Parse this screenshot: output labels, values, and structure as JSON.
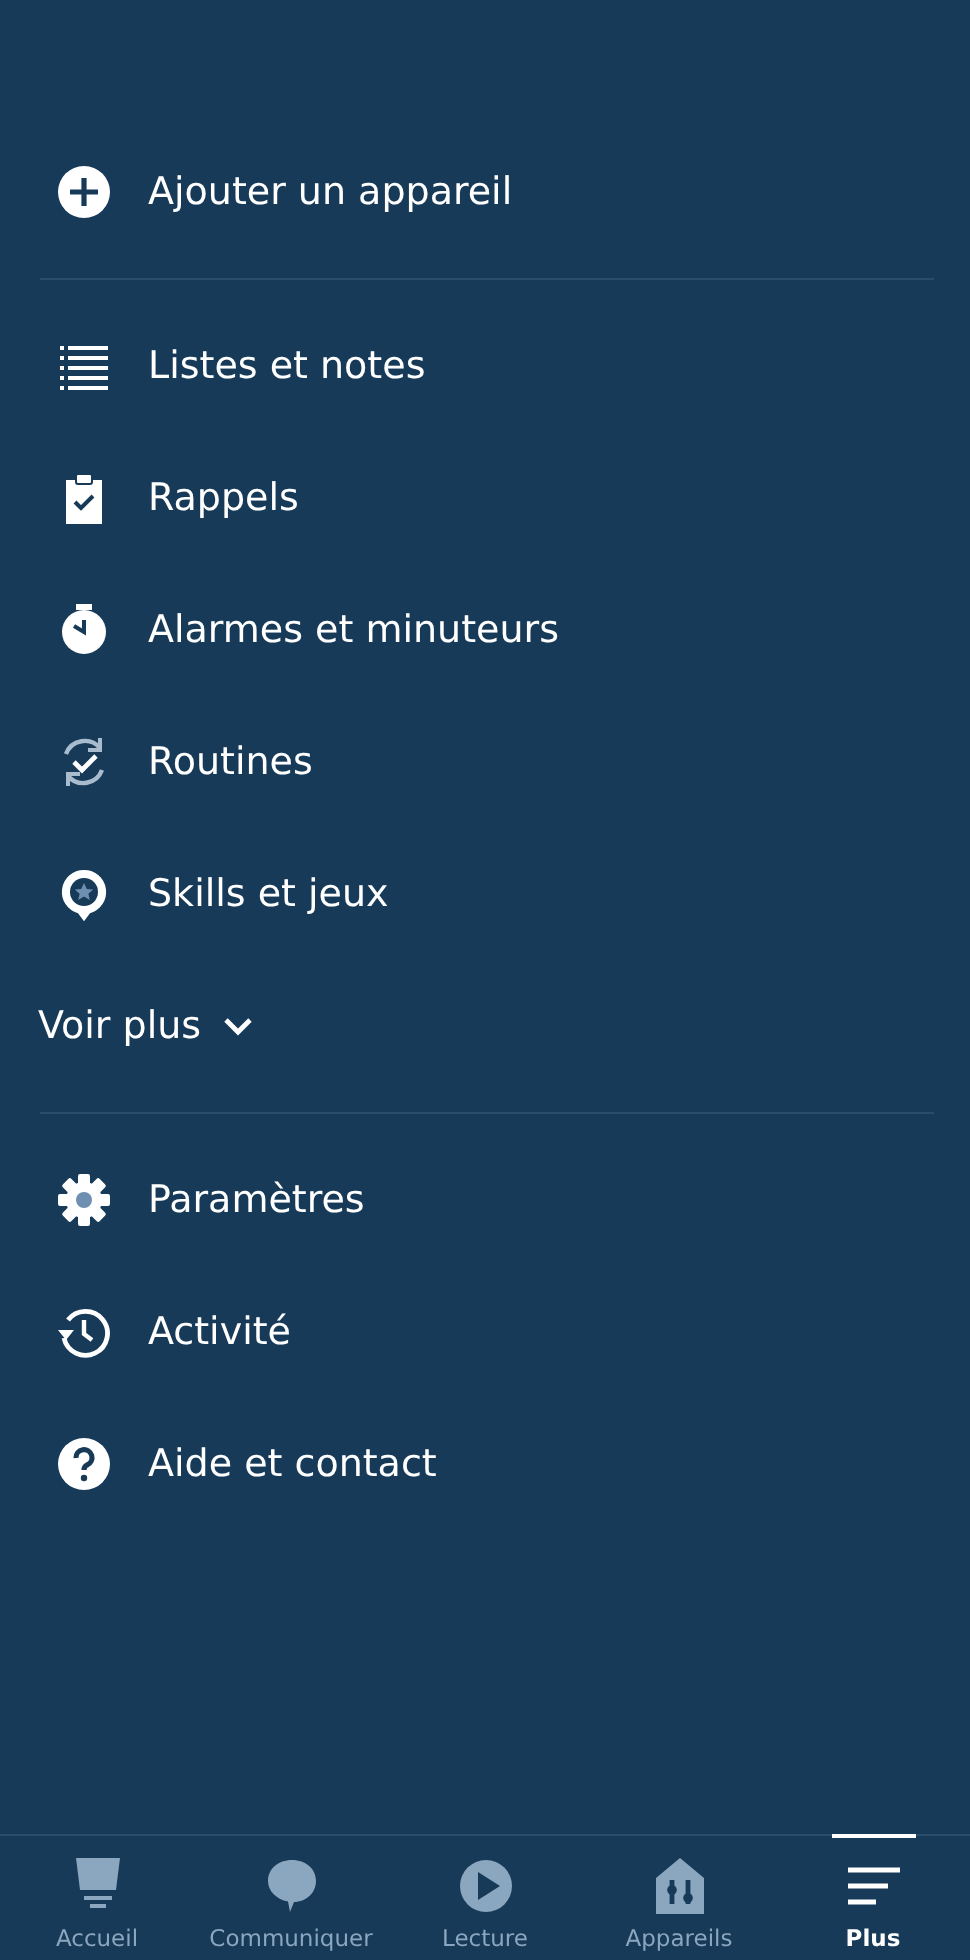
{
  "menu_sections": [
    {
      "items": [
        {
          "label": "Ajouter un appareil",
          "kind": "add"
        }
      ]
    },
    {
      "items": [
        {
          "label": "Listes et notes",
          "kind": "list"
        },
        {
          "label": "Rappels",
          "kind": "clipboard"
        },
        {
          "label": "Alarmes et minuteurs",
          "kind": "alarm"
        },
        {
          "label": "Routines",
          "kind": "routine"
        },
        {
          "label": "Skills et jeux",
          "kind": "skill"
        }
      ],
      "more": "Voir plus"
    },
    {
      "items": [
        {
          "label": "Paramètres",
          "kind": "gear"
        },
        {
          "label": "Activité",
          "kind": "history"
        },
        {
          "label": "Aide et contact",
          "kind": "help"
        }
      ]
    }
  ],
  "bottom_nav": [
    {
      "label": "Accueil",
      "kind": "home",
      "selected": false
    },
    {
      "label": "Communiquer",
      "kind": "chat",
      "selected": false
    },
    {
      "label": "Lecture",
      "kind": "play",
      "selected": false
    },
    {
      "label": "Appareils",
      "kind": "devices",
      "selected": false
    },
    {
      "label": "Plus",
      "kind": "more",
      "selected": true
    }
  ]
}
